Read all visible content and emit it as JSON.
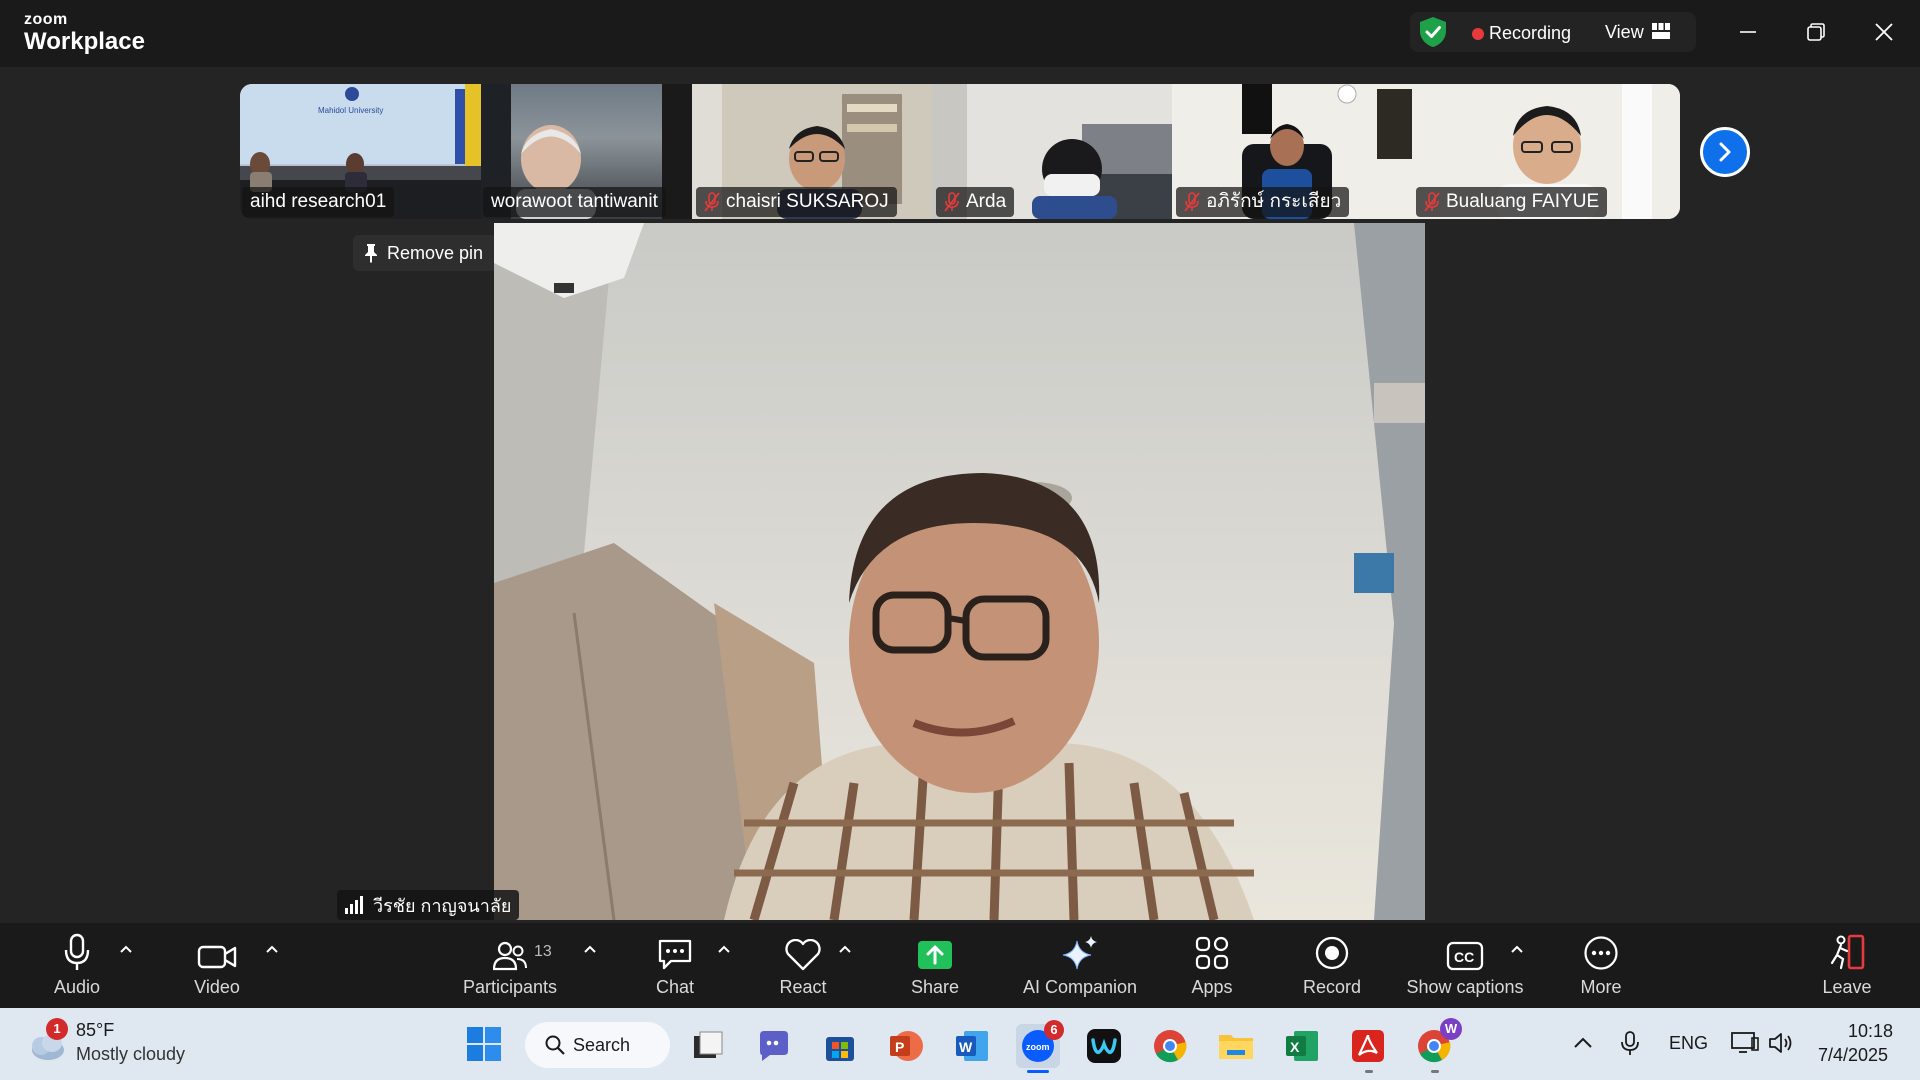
{
  "titlebar": {
    "brand_top": "zoom",
    "brand_bottom": "Workplace",
    "recording_label": "Recording",
    "view_label": "View"
  },
  "filmstrip": {
    "tiles": [
      {
        "name": "aihd research01",
        "muted": false,
        "sign_text": "Mahidol University"
      },
      {
        "name": "worawoot tantiwanit",
        "muted": false
      },
      {
        "name": "chaisri SUKSAROJ",
        "muted": true
      },
      {
        "name": "Arda",
        "muted": true
      },
      {
        "name": "อภิรักษ์ กระเสียว",
        "muted": true
      },
      {
        "name": "Bualuang FAIYUE",
        "muted": true
      }
    ]
  },
  "pin": {
    "label": "Remove pin"
  },
  "speaker": {
    "name": "วีรชัย กาญจนาลัย"
  },
  "toolbar": {
    "audio": "Audio",
    "video": "Video",
    "participants": "Participants",
    "participants_count": "13",
    "chat": "Chat",
    "react": "React",
    "share": "Share",
    "ai_companion": "AI Companion",
    "apps": "Apps",
    "record": "Record",
    "show_captions": "Show captions",
    "more": "More",
    "leave": "Leave"
  },
  "taskbar": {
    "weather_temp": "85°F",
    "weather_desc": "Mostly cloudy",
    "weather_badge": "1",
    "search_label": "Search",
    "zoom_badge": "6",
    "chrome_profile": "W",
    "language": "ENG",
    "time": "10:18",
    "date": "7/4/2025"
  },
  "colors": {
    "accent_blue": "#0e71eb",
    "recording_red": "#e8393b",
    "shield_green": "#1fa14a",
    "share_green": "#21c05b",
    "leave_red": "#e8393b"
  }
}
